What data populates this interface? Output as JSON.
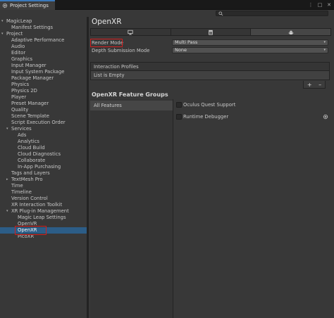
{
  "window": {
    "tab_title": "Project Settings",
    "menu_dots": "⋮",
    "maximize": "□",
    "close": "✕"
  },
  "search": {
    "placeholder": ""
  },
  "sidebar": {
    "items": [
      {
        "label": "MagicLeap",
        "arrow": "▾"
      },
      {
        "label": "Manifest Settings",
        "arrow": ""
      },
      {
        "label": "Project",
        "arrow": "▾"
      },
      {
        "label": "Adaptive Performance",
        "arrow": ""
      },
      {
        "label": "Audio",
        "arrow": ""
      },
      {
        "label": "Editor",
        "arrow": ""
      },
      {
        "label": "Graphics",
        "arrow": ""
      },
      {
        "label": "Input Manager",
        "arrow": ""
      },
      {
        "label": "Input System Package",
        "arrow": ""
      },
      {
        "label": "Package Manager",
        "arrow": ""
      },
      {
        "label": "Physics",
        "arrow": ""
      },
      {
        "label": "Physics 2D",
        "arrow": ""
      },
      {
        "label": "Player",
        "arrow": ""
      },
      {
        "label": "Preset Manager",
        "arrow": ""
      },
      {
        "label": "Quality",
        "arrow": ""
      },
      {
        "label": "Scene Template",
        "arrow": ""
      },
      {
        "label": "Script Execution Order",
        "arrow": ""
      },
      {
        "label": "Services",
        "arrow": "▾"
      },
      {
        "label": "Ads",
        "arrow": ""
      },
      {
        "label": "Analytics",
        "arrow": ""
      },
      {
        "label": "Cloud Build",
        "arrow": ""
      },
      {
        "label": "Cloud Diagnostics",
        "arrow": ""
      },
      {
        "label": "Collaborate",
        "arrow": ""
      },
      {
        "label": "In-App Purchasing",
        "arrow": ""
      },
      {
        "label": "Tags and Layers",
        "arrow": ""
      },
      {
        "label": "TextMesh Pro",
        "arrow": "▸"
      },
      {
        "label": "Time",
        "arrow": ""
      },
      {
        "label": "Timeline",
        "arrow": ""
      },
      {
        "label": "Version Control",
        "arrow": ""
      },
      {
        "label": "XR Interaction Toolkit",
        "arrow": ""
      },
      {
        "label": "XR Plug-in Management",
        "arrow": "▾"
      },
      {
        "label": "Magic Leap Settings",
        "arrow": ""
      },
      {
        "label": "OpenVR",
        "arrow": ""
      },
      {
        "label": "OpenXR",
        "arrow": ""
      },
      {
        "label": "PicoXR",
        "arrow": ""
      }
    ]
  },
  "main": {
    "title": "OpenXR",
    "platform_tabs": [
      "standalone-icon",
      "webgl-icon",
      "android-icon"
    ],
    "render_mode": {
      "label": "Render Mode",
      "value": "Multi Pass",
      "caret": "▾"
    },
    "depth_submission": {
      "label": "Depth Submission Mode",
      "value": "None",
      "caret": "▾"
    },
    "interaction_profiles": {
      "header": "Interaction Profiles",
      "empty_text": "List is Empty",
      "add": "+",
      "remove": "–"
    },
    "feature_groups": {
      "title": "OpenXR Feature Groups",
      "groups": [
        "All Features"
      ],
      "features": [
        {
          "label": "Oculus Quest Support",
          "checked": false
        },
        {
          "label": "Runtime Debugger",
          "checked": false
        }
      ]
    }
  },
  "colors": {
    "selection": "#2c5d87",
    "annotation_red": "#d41e1e",
    "panel": "#383838"
  }
}
